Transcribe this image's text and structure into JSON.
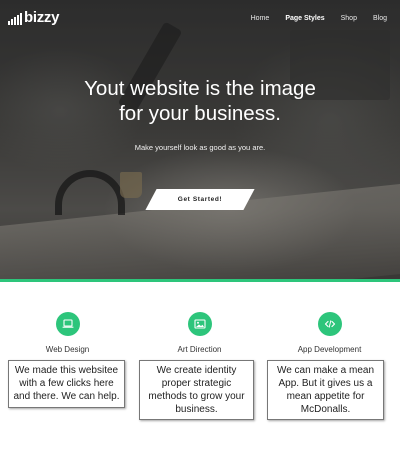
{
  "brand": {
    "name": "bizzy"
  },
  "nav": {
    "items": [
      {
        "label": "Home",
        "active": false
      },
      {
        "label": "Page Styles",
        "active": true
      },
      {
        "label": "Shop",
        "active": false
      },
      {
        "label": "Blog",
        "active": false
      }
    ]
  },
  "hero": {
    "headline_line1": "Yout website is the image",
    "headline_line2": "for your business.",
    "subtitle": "Make yourself look as good as you are.",
    "cta_label": "Get Started!"
  },
  "colors": {
    "accent": "#2dc57b"
  },
  "features": [
    {
      "icon": "laptop-icon",
      "title": "Web Design",
      "text": "We made this websitee with a few clicks here and there. We can help."
    },
    {
      "icon": "image-icon",
      "title": "Art Direction",
      "text": "We create identity proper strategic methods to grow your business."
    },
    {
      "icon": "code-icon",
      "title": "App Development",
      "text": "We can make a mean App. But it gives us a mean appetite for McDonalls."
    }
  ]
}
